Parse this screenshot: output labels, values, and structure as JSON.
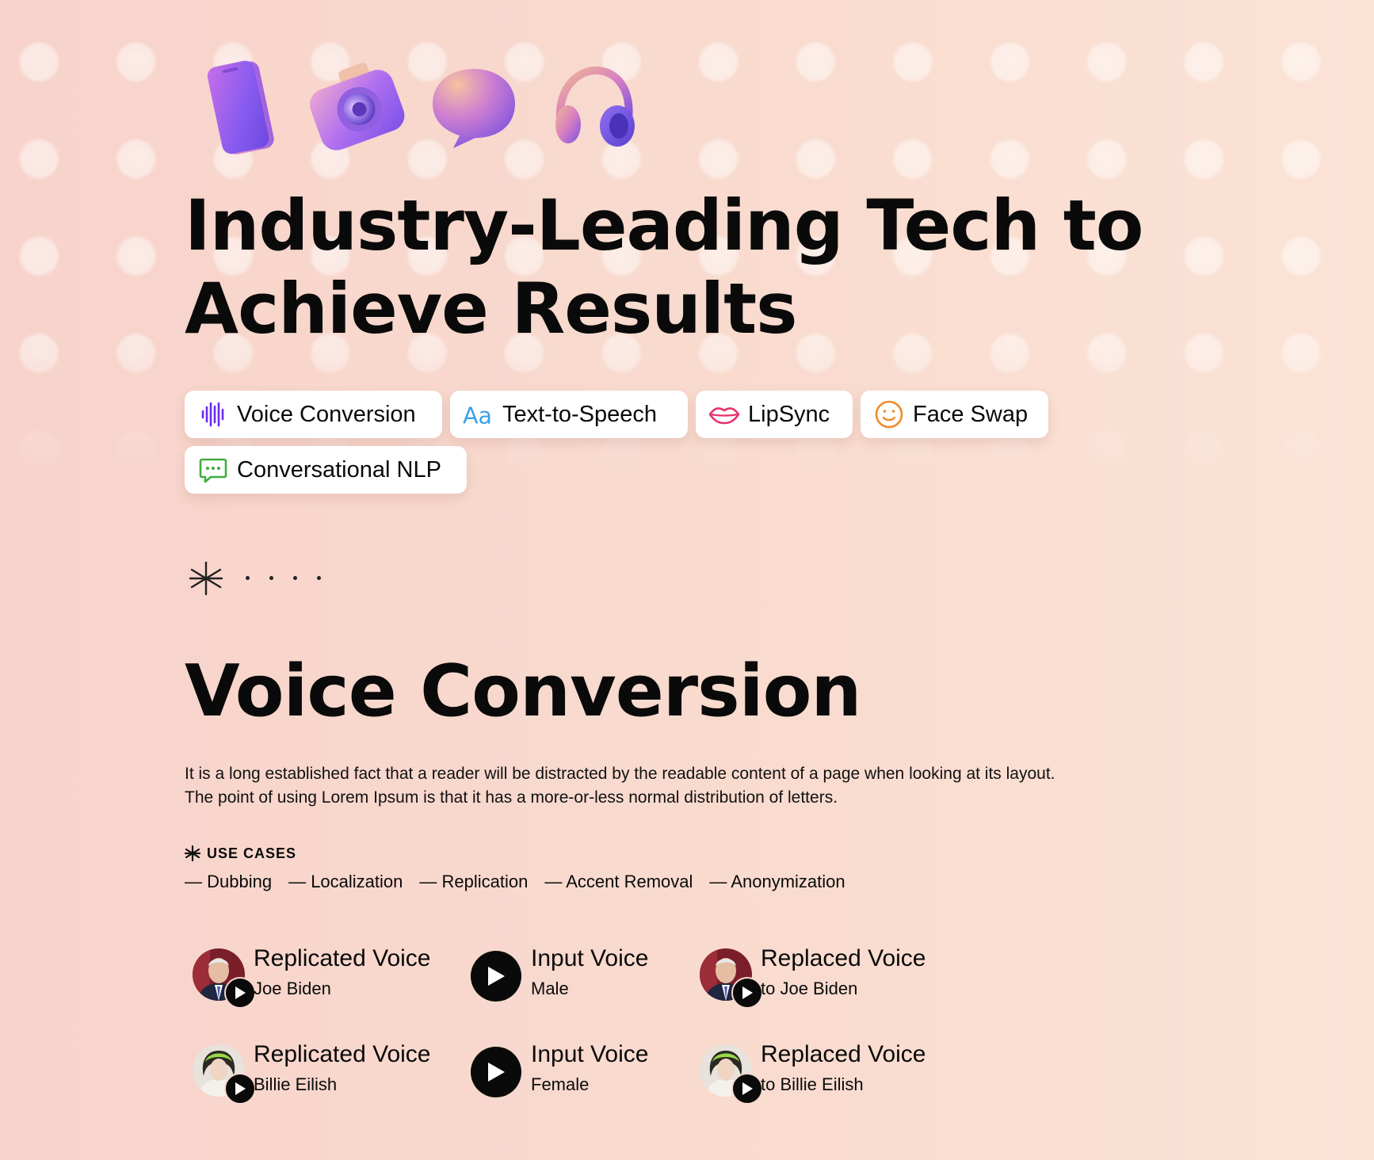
{
  "hero": {
    "icons": [
      "phone-3d-icon",
      "camera-3d-icon",
      "speech-bubble-3d-icon",
      "headphones-3d-icon"
    ],
    "title_line1": "Industry-Leading Tech to",
    "title_line2": "Achieve Results"
  },
  "features": [
    {
      "label": "Voice Conversion",
      "icon": "waveform-icon",
      "color": "#6a2cf0"
    },
    {
      "label": "Text-to-Speech",
      "icon": "aa-text-icon",
      "color": "#3aa0e8"
    },
    {
      "label": "LipSync",
      "icon": "lips-icon",
      "color": "#e8336b"
    },
    {
      "label": "Face Swap",
      "icon": "smiley-face-icon",
      "color": "#f08a2c"
    },
    {
      "label": "Conversational NLP",
      "icon": "chat-bubble-icon",
      "color": "#3cae3c"
    }
  ],
  "section": {
    "title": "Voice Conversion",
    "description_line1": "It is a long established fact that a reader will be distracted by the readable content of a page when looking at its layout.",
    "description_line2": "The point of using Lorem Ipsum is that it has a more-or-less normal distribution of letters.",
    "use_cases_heading": "USE CASES",
    "use_cases": [
      "— Dubbing",
      "— Localization",
      "— Replication",
      "— Accent Removal",
      "— Anonymization"
    ]
  },
  "voices": [
    {
      "title": "Replicated Voice",
      "subtitle": "Joe Biden",
      "type": "avatar"
    },
    {
      "title": "Input Voice",
      "subtitle": "Male",
      "type": "play"
    },
    {
      "title": "Replaced Voice",
      "subtitle": "to Joe Biden",
      "type": "avatar"
    },
    {
      "title": "Replicated Voice",
      "subtitle": "Billie Eilish",
      "type": "avatar"
    },
    {
      "title": "Input Voice",
      "subtitle": "Female",
      "type": "play"
    },
    {
      "title": "Replaced Voice",
      "subtitle": "to Billie Eilish",
      "type": "avatar"
    }
  ],
  "colors": {
    "background": "#f8d8cd",
    "text": "#0a0a0a",
    "pill_background": "#ffffff",
    "icon_gradient_start": "#8a5cf0",
    "icon_gradient_end": "#f0a070"
  }
}
